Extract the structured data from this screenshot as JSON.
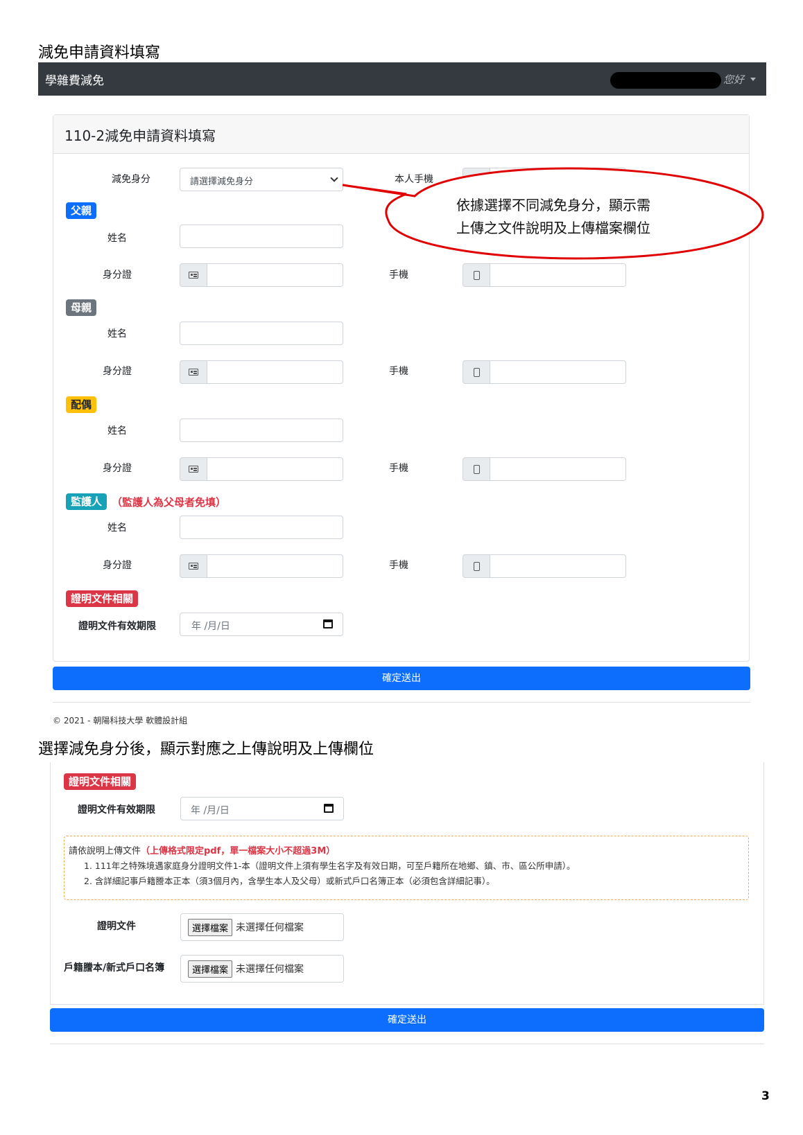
{
  "doc": {
    "heading1": "減免申請資料填寫",
    "heading2": "選擇減免身分後，顯示對應之上傳說明及上傳欄位",
    "page_number": "3"
  },
  "navbar": {
    "brand": "學雜費減免",
    "user_greeting": "您好"
  },
  "form": {
    "title": "110-2減免申請資料填寫",
    "identity_label": "減免身分",
    "identity_placeholder": "請選擇減免身分",
    "own_phone_label": "本人手機",
    "sections": {
      "father": "父親",
      "mother": "母親",
      "spouse": "配偶",
      "guardian": "監護人",
      "guardian_note": "（監護人為父母者免填）",
      "docs": "證明文件相關"
    },
    "name_label": "姓名",
    "id_label": "身分證",
    "phone_label": "手機",
    "doc_expiry_label": "證明文件有效期限",
    "date_placeholder": "年 /月/日",
    "submit": "確定送出"
  },
  "callout": {
    "line1": "依據選擇不同減免身分，顯示需",
    "line2": "上傳之文件說明及上傳檔案欄位"
  },
  "footer": {
    "text": "© 2021 - 朝陽科技大學 軟體設計組"
  },
  "upload": {
    "section_badge": "證明文件相關",
    "doc_expiry_label": "證明文件有效期限",
    "date_placeholder": "年 /月/日",
    "note_intro": "請依說明上傳文件",
    "note_red": "（上傳格式限定pdf，單一檔案大小不超過3M）",
    "note_items": [
      "1. 111年之特殊境遇家庭身分證明文件1-本（證明文件上須有學生名字及有效日期，可至戶籍所在地鄉、鎮、市、區公所申請）。",
      "2. 含詳細記事戶籍謄本正本（須3個月內，含學生本人及父母）或新式戶口名簿正本（必須包含詳細記事）。"
    ],
    "field1_label": "證明文件",
    "field2_label": "戶籍謄本/新式戶口名簿",
    "choose_file": "選擇檔案",
    "no_file": "未選擇任何檔案",
    "submit": "確定送出"
  },
  "colors": {
    "navbar": "#343a40",
    "primary": "#0d6efd",
    "secondary": "#6c757d",
    "warning": "#ffc107",
    "info": "#17a2b8",
    "danger": "#dc3545",
    "callout_stroke": "#e00000"
  }
}
